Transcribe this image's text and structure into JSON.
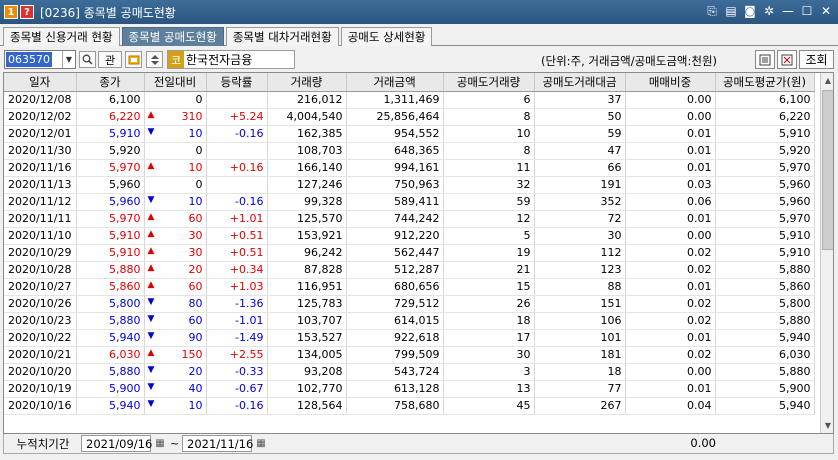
{
  "window": {
    "badge1": "1",
    "badge2": "?",
    "title": "[0236] 종목별 공매도현황"
  },
  "tabs": [
    {
      "label": "종목별 신용거래 현황"
    },
    {
      "label": "종목별 공매도현황"
    },
    {
      "label": "종목별 대차거래현황"
    },
    {
      "label": "공매도 상세현황"
    }
  ],
  "toolbar": {
    "code": "063570",
    "related_label": "관",
    "stock_badge": "코",
    "stock_name": "한국전자금융",
    "unit_text": "(단위:주, 거래금액/공매도금액:천원)",
    "query_label": "조회"
  },
  "table": {
    "headers": [
      "일자",
      "종가",
      "전일대비",
      "등락률",
      "거래량",
      "거래금액",
      "공매도거래량",
      "공매도거래대금",
      "매매비중",
      "공매도평균가(원)"
    ],
    "rows": [
      {
        "date": "2020/12/08",
        "close": "6,100",
        "dir": "flat",
        "chg": "0",
        "rate": "",
        "vol": "216,012",
        "amt": "1,311,469",
        "svol": "6",
        "samt": "37",
        "ratio": "0.00",
        "avg": "6,100"
      },
      {
        "date": "2020/12/02",
        "close": "6,220",
        "dir": "up",
        "chg": "310",
        "rate": "+5.24",
        "vol": "4,004,540",
        "amt": "25,856,464",
        "svol": "8",
        "samt": "50",
        "ratio": "0.00",
        "avg": "6,220"
      },
      {
        "date": "2020/12/01",
        "close": "5,910",
        "dir": "down",
        "chg": "10",
        "rate": "-0.16",
        "vol": "162,385",
        "amt": "954,552",
        "svol": "10",
        "samt": "59",
        "ratio": "0.01",
        "avg": "5,910"
      },
      {
        "date": "2020/11/30",
        "close": "5,920",
        "dir": "flat",
        "chg": "0",
        "rate": "",
        "vol": "108,703",
        "amt": "648,365",
        "svol": "8",
        "samt": "47",
        "ratio": "0.01",
        "avg": "5,920"
      },
      {
        "date": "2020/11/16",
        "close": "5,970",
        "dir": "up",
        "chg": "10",
        "rate": "+0.16",
        "vol": "166,140",
        "amt": "994,161",
        "svol": "11",
        "samt": "66",
        "ratio": "0.01",
        "avg": "5,970"
      },
      {
        "date": "2020/11/13",
        "close": "5,960",
        "dir": "flat",
        "chg": "0",
        "rate": "",
        "vol": "127,246",
        "amt": "750,963",
        "svol": "32",
        "samt": "191",
        "ratio": "0.03",
        "avg": "5,960"
      },
      {
        "date": "2020/11/12",
        "close": "5,960",
        "dir": "down",
        "chg": "10",
        "rate": "-0.16",
        "vol": "99,328",
        "amt": "589,411",
        "svol": "59",
        "samt": "352",
        "ratio": "0.06",
        "avg": "5,960"
      },
      {
        "date": "2020/11/11",
        "close": "5,970",
        "dir": "up",
        "chg": "60",
        "rate": "+1.01",
        "vol": "125,570",
        "amt": "744,242",
        "svol": "12",
        "samt": "72",
        "ratio": "0.01",
        "avg": "5,970"
      },
      {
        "date": "2020/11/10",
        "close": "5,910",
        "dir": "up",
        "chg": "30",
        "rate": "+0.51",
        "vol": "153,921",
        "amt": "912,220",
        "svol": "5",
        "samt": "30",
        "ratio": "0.00",
        "avg": "5,910"
      },
      {
        "date": "2020/10/29",
        "close": "5,910",
        "dir": "up",
        "chg": "30",
        "rate": "+0.51",
        "vol": "96,242",
        "amt": "562,447",
        "svol": "19",
        "samt": "112",
        "ratio": "0.02",
        "avg": "5,910"
      },
      {
        "date": "2020/10/28",
        "close": "5,880",
        "dir": "up",
        "chg": "20",
        "rate": "+0.34",
        "vol": "87,828",
        "amt": "512,287",
        "svol": "21",
        "samt": "123",
        "ratio": "0.02",
        "avg": "5,880"
      },
      {
        "date": "2020/10/27",
        "close": "5,860",
        "dir": "up",
        "chg": "60",
        "rate": "+1.03",
        "vol": "116,951",
        "amt": "680,656",
        "svol": "15",
        "samt": "88",
        "ratio": "0.01",
        "avg": "5,860"
      },
      {
        "date": "2020/10/26",
        "close": "5,800",
        "dir": "down",
        "chg": "80",
        "rate": "-1.36",
        "vol": "125,783",
        "amt": "729,512",
        "svol": "26",
        "samt": "151",
        "ratio": "0.02",
        "avg": "5,800"
      },
      {
        "date": "2020/10/23",
        "close": "5,880",
        "dir": "down",
        "chg": "60",
        "rate": "-1.01",
        "vol": "103,707",
        "amt": "614,015",
        "svol": "18",
        "samt": "106",
        "ratio": "0.02",
        "avg": "5,880"
      },
      {
        "date": "2020/10/22",
        "close": "5,940",
        "dir": "down",
        "chg": "90",
        "rate": "-1.49",
        "vol": "153,527",
        "amt": "922,618",
        "svol": "17",
        "samt": "101",
        "ratio": "0.01",
        "avg": "5,940"
      },
      {
        "date": "2020/10/21",
        "close": "6,030",
        "dir": "up",
        "chg": "150",
        "rate": "+2.55",
        "vol": "134,005",
        "amt": "799,509",
        "svol": "30",
        "samt": "181",
        "ratio": "0.02",
        "avg": "6,030"
      },
      {
        "date": "2020/10/20",
        "close": "5,880",
        "dir": "down",
        "chg": "20",
        "rate": "-0.33",
        "vol": "93,208",
        "amt": "543,724",
        "svol": "3",
        "samt": "18",
        "ratio": "0.00",
        "avg": "5,880"
      },
      {
        "date": "2020/10/19",
        "close": "5,900",
        "dir": "down",
        "chg": "40",
        "rate": "-0.67",
        "vol": "102,770",
        "amt": "613,128",
        "svol": "13",
        "samt": "77",
        "ratio": "0.01",
        "avg": "5,900"
      },
      {
        "date": "2020/10/16",
        "close": "5,940",
        "dir": "down",
        "chg": "10",
        "rate": "-0.16",
        "vol": "128,564",
        "amt": "758,680",
        "svol": "45",
        "samt": "267",
        "ratio": "0.04",
        "avg": "5,940"
      }
    ]
  },
  "footer": {
    "label": "누적치기간",
    "from": "2021/09/16",
    "tilde": "~",
    "to": "2021/11/16",
    "ratio": "0.00"
  },
  "colors": {
    "up": "#e00000",
    "down": "#0000d8",
    "active_tab": "#5e7f9c",
    "titlebar": "#2b5580"
  },
  "icons": {
    "up": "▲",
    "down": "▼"
  }
}
